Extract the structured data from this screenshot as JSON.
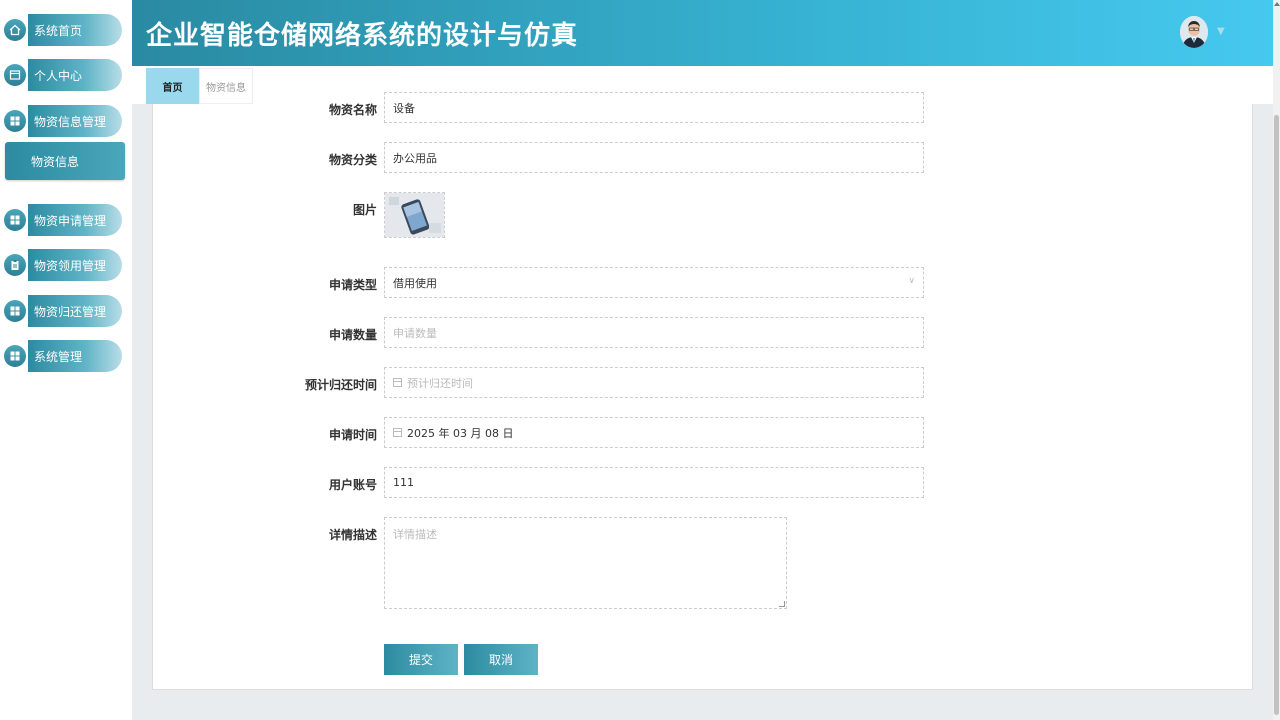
{
  "app": {
    "title": "企业智能仓储网络系统的设计与仿真"
  },
  "sidebar": {
    "items": [
      {
        "label": "系统首页",
        "icon": "home-icon"
      },
      {
        "label": "个人中心",
        "icon": "profile-card-icon"
      },
      {
        "label": "物资信息管理",
        "icon": "grid-icon"
      },
      {
        "label": "物资申请管理",
        "icon": "grid-icon"
      },
      {
        "label": "物资领用管理",
        "icon": "clipboard-icon"
      },
      {
        "label": "物资归还管理",
        "icon": "grid-icon"
      },
      {
        "label": "系统管理",
        "icon": "grid-icon"
      }
    ],
    "active_sub": "物资信息"
  },
  "tabs": [
    {
      "label": "首页"
    },
    {
      "label": "物资信息"
    }
  ],
  "form": {
    "name_label": "物资名称",
    "name_value": "设备",
    "category_label": "物资分类",
    "category_value": "办公用品",
    "image_label": "图片",
    "apply_type_label": "申请类型",
    "apply_type_value": "借用使用",
    "apply_qty_label": "申请数量",
    "apply_qty_placeholder": "申请数量",
    "return_time_label": "预计归还时间",
    "return_time_placeholder": "预计归还时间",
    "apply_time_label": "申请时间",
    "apply_time_value": "2025 年 03 月 08 日",
    "account_label": "用户账号",
    "account_value": "111",
    "desc_label": "详情描述",
    "desc_placeholder": "详情描述",
    "submit_label": "提交",
    "cancel_label": "取消"
  },
  "colors": {
    "accent": "#2c8ba1",
    "header_end": "#46c9ef",
    "tab_active": "#9ad8ee"
  }
}
